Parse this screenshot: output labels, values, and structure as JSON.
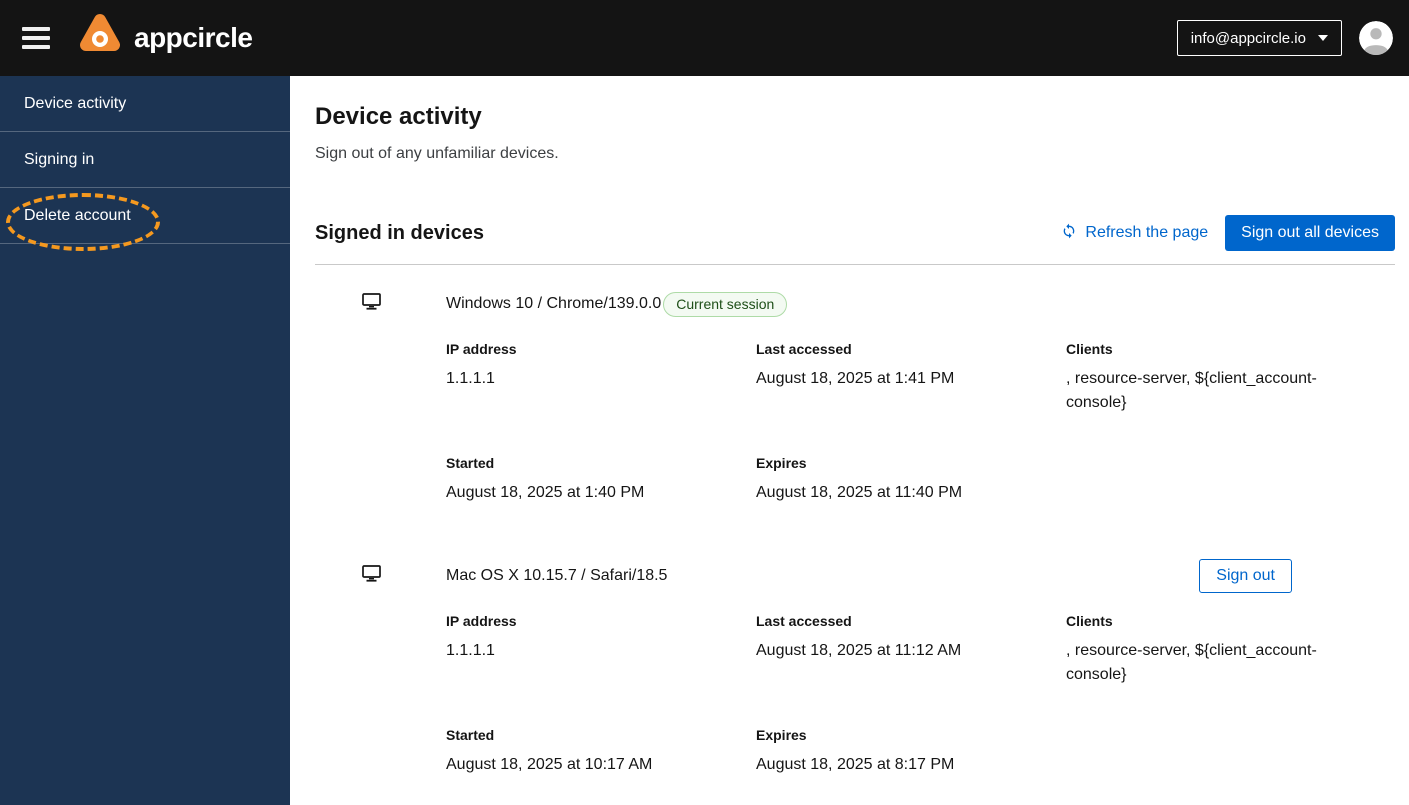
{
  "header": {
    "brand": "appcircle",
    "user_email": "info@appcircle.io"
  },
  "sidebar": {
    "items": [
      {
        "label": "Device activity"
      },
      {
        "label": "Signing in"
      },
      {
        "label": "Delete account"
      }
    ]
  },
  "page": {
    "title": "Device activity",
    "subtitle": "Sign out of any unfamiliar devices.",
    "section": {
      "title": "Signed in devices",
      "refresh_label": "Refresh the page",
      "sign_out_all_label": "Sign out all devices"
    }
  },
  "labels": {
    "ip": "IP address",
    "last_accessed": "Last accessed",
    "clients": "Clients",
    "started": "Started",
    "expires": "Expires"
  },
  "devices": [
    {
      "title": "Windows 10 / Chrome/139.0.0",
      "badge": "Current session",
      "ip": "1.1.1.1",
      "last_accessed": "August 18, 2025 at 1:41 PM",
      "clients": ", resource-server, ${client_account-console}",
      "started": "August 18, 2025 at 1:40 PM",
      "expires": "August 18, 2025 at 11:40 PM"
    },
    {
      "title": "Mac OS X 10.15.7 / Safari/18.5",
      "sign_out_label": "Sign out",
      "ip": "1.1.1.1",
      "last_accessed": "August 18, 2025 at 11:12 AM",
      "clients": ", resource-server, ${client_account-console}",
      "started": "August 18, 2025 at 10:17 AM",
      "expires": "August 18, 2025 at 8:17 PM"
    }
  ],
  "colors": {
    "accent_blue": "#0066cc",
    "header_bg": "#141414",
    "sidebar_bg": "#1c3453",
    "brand_orange": "#f08a33",
    "annotation_orange": "#f5991f",
    "badge_green_bg": "#f3faf2",
    "badge_green_border": "#aedba7",
    "badge_green_text": "#1e4f18"
  }
}
